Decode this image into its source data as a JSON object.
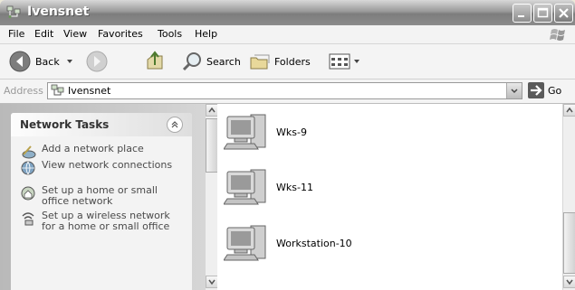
{
  "window": {
    "title": "Ivensnet"
  },
  "menu": [
    "File",
    "Edit",
    "View",
    "Favorites",
    "Tools",
    "Help"
  ],
  "toolbar": {
    "back_label": "Back",
    "search_label": "Search",
    "folders_label": "Folders"
  },
  "address": {
    "label": "Address",
    "value": "Ivensnet",
    "go_label": "Go"
  },
  "task_pane": {
    "title": "Network Tasks",
    "tasks": [
      "Add a network place",
      "View network connections",
      "Set up a home or small office network",
      "Set up a wireless network for a home or small office"
    ]
  },
  "computers": [
    "Wks-9",
    "Wks-11",
    "Workstation-10"
  ]
}
